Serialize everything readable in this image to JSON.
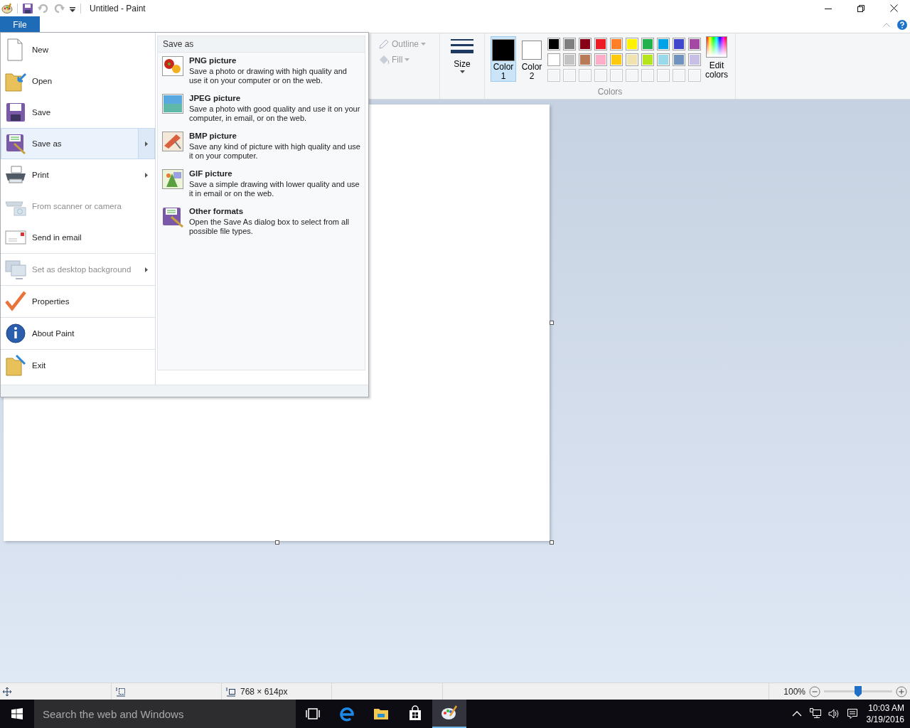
{
  "window": {
    "title": "Untitled - Paint"
  },
  "ribbon": {
    "file_tab": "File",
    "shape_options": [
      {
        "label": "Outline",
        "disabled": true
      },
      {
        "label": "Fill",
        "disabled": true
      }
    ],
    "size_label": "Size",
    "color_slots": [
      {
        "label": "Color 1",
        "color": "#000000",
        "selected": true
      },
      {
        "label": "Color 2",
        "color": "#ffffff",
        "selected": false
      }
    ],
    "palette": [
      {
        "color": "#000000"
      },
      {
        "color": "#7f7f7f"
      },
      {
        "color": "#880015"
      },
      {
        "color": "#ed1c24"
      },
      {
        "color": "#ff7f27"
      },
      {
        "color": "#fff200"
      },
      {
        "color": "#22b14c"
      },
      {
        "color": "#00a2e8"
      },
      {
        "color": "#3f48cc"
      },
      {
        "color": "#a349a4"
      },
      {
        "color": "#ffffff"
      },
      {
        "color": "#c3c3c3"
      },
      {
        "color": "#b97a57"
      },
      {
        "color": "#ffaec9"
      },
      {
        "color": "#ffc90e"
      },
      {
        "color": "#efe4b0"
      },
      {
        "color": "#b5e61d"
      },
      {
        "color": "#99d9ea"
      },
      {
        "color": "#7092be"
      },
      {
        "color": "#c8bfe7"
      }
    ],
    "edit_colors": "Edit colors",
    "colors_group": "Colors"
  },
  "file_menu": {
    "groups": [
      [
        {
          "label": "New",
          "disabled": false,
          "submenu": false,
          "selected": false
        },
        {
          "label": "Open",
          "disabled": false,
          "submenu": false,
          "selected": false
        },
        {
          "label": "Save",
          "disabled": false,
          "submenu": false,
          "selected": false
        },
        {
          "label": "Save as",
          "disabled": false,
          "submenu": true,
          "selected": true
        },
        {
          "label": "Print",
          "disabled": false,
          "submenu": true,
          "selected": false
        },
        {
          "label": "From scanner or camera",
          "disabled": true,
          "submenu": false,
          "selected": false
        },
        {
          "label": "Send in email",
          "disabled": false,
          "submenu": false,
          "selected": false
        }
      ],
      [
        {
          "label": "Set as desktop background",
          "disabled": true,
          "submenu": true,
          "selected": false
        }
      ],
      [
        {
          "label": "Properties",
          "disabled": false,
          "submenu": false,
          "selected": false
        }
      ],
      [
        {
          "label": "About Paint",
          "disabled": false,
          "submenu": false,
          "selected": false
        }
      ],
      [
        {
          "label": "Exit",
          "disabled": false,
          "submenu": false,
          "selected": false
        }
      ]
    ],
    "submenu": {
      "header": "Save as",
      "options": [
        {
          "title": "PNG picture",
          "description": "Save a photo or drawing with high quality and use it on your computer or on the web."
        },
        {
          "title": "JPEG picture",
          "description": "Save a photo with good quality and use it on your computer, in email, or on the web."
        },
        {
          "title": "BMP picture",
          "description": "Save any kind of picture with high quality and use it on your computer."
        },
        {
          "title": "GIF picture",
          "description": "Save a simple drawing with lower quality and use it in email or on the web."
        },
        {
          "title": "Other formats",
          "description": "Open the Save As dialog box to select from all possible file types."
        }
      ]
    }
  },
  "status_bar": {
    "image_size": "768 × 614px",
    "zoom": "100%",
    "zoom_slider": {
      "level": 0.5
    }
  },
  "taskbar": {
    "search_placeholder": "Search the web and Windows",
    "time": "10:03 AM",
    "date": "3/19/2016"
  }
}
